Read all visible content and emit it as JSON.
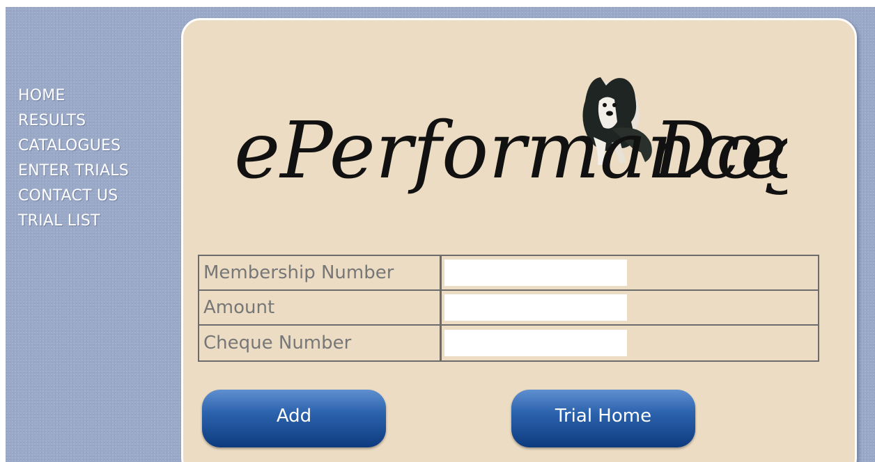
{
  "nav": {
    "items": [
      {
        "label": "HOME"
      },
      {
        "label": "RESULTS"
      },
      {
        "label": "CATALOGUES"
      },
      {
        "label": "ENTER TRIALS"
      },
      {
        "label": "CONTACT US"
      },
      {
        "label": "TRIAL LIST"
      }
    ]
  },
  "logo": {
    "text_part1": "ePerformance",
    "text_part2": "Dogs"
  },
  "form": {
    "fields": [
      {
        "label": "Membership Number",
        "value": ""
      },
      {
        "label": "Amount",
        "value": ""
      },
      {
        "label": "Cheque Number",
        "value": ""
      }
    ]
  },
  "buttons": {
    "add_label": "Add",
    "trial_home_label": "Trial Home"
  },
  "colors": {
    "page_background": "#9aa9c7",
    "panel_background": "#ecdcc3",
    "nav_text": "#ffffff",
    "label_text": "#777777",
    "button_top": "#5f8fd0",
    "button_bottom": "#0d3a7e"
  }
}
